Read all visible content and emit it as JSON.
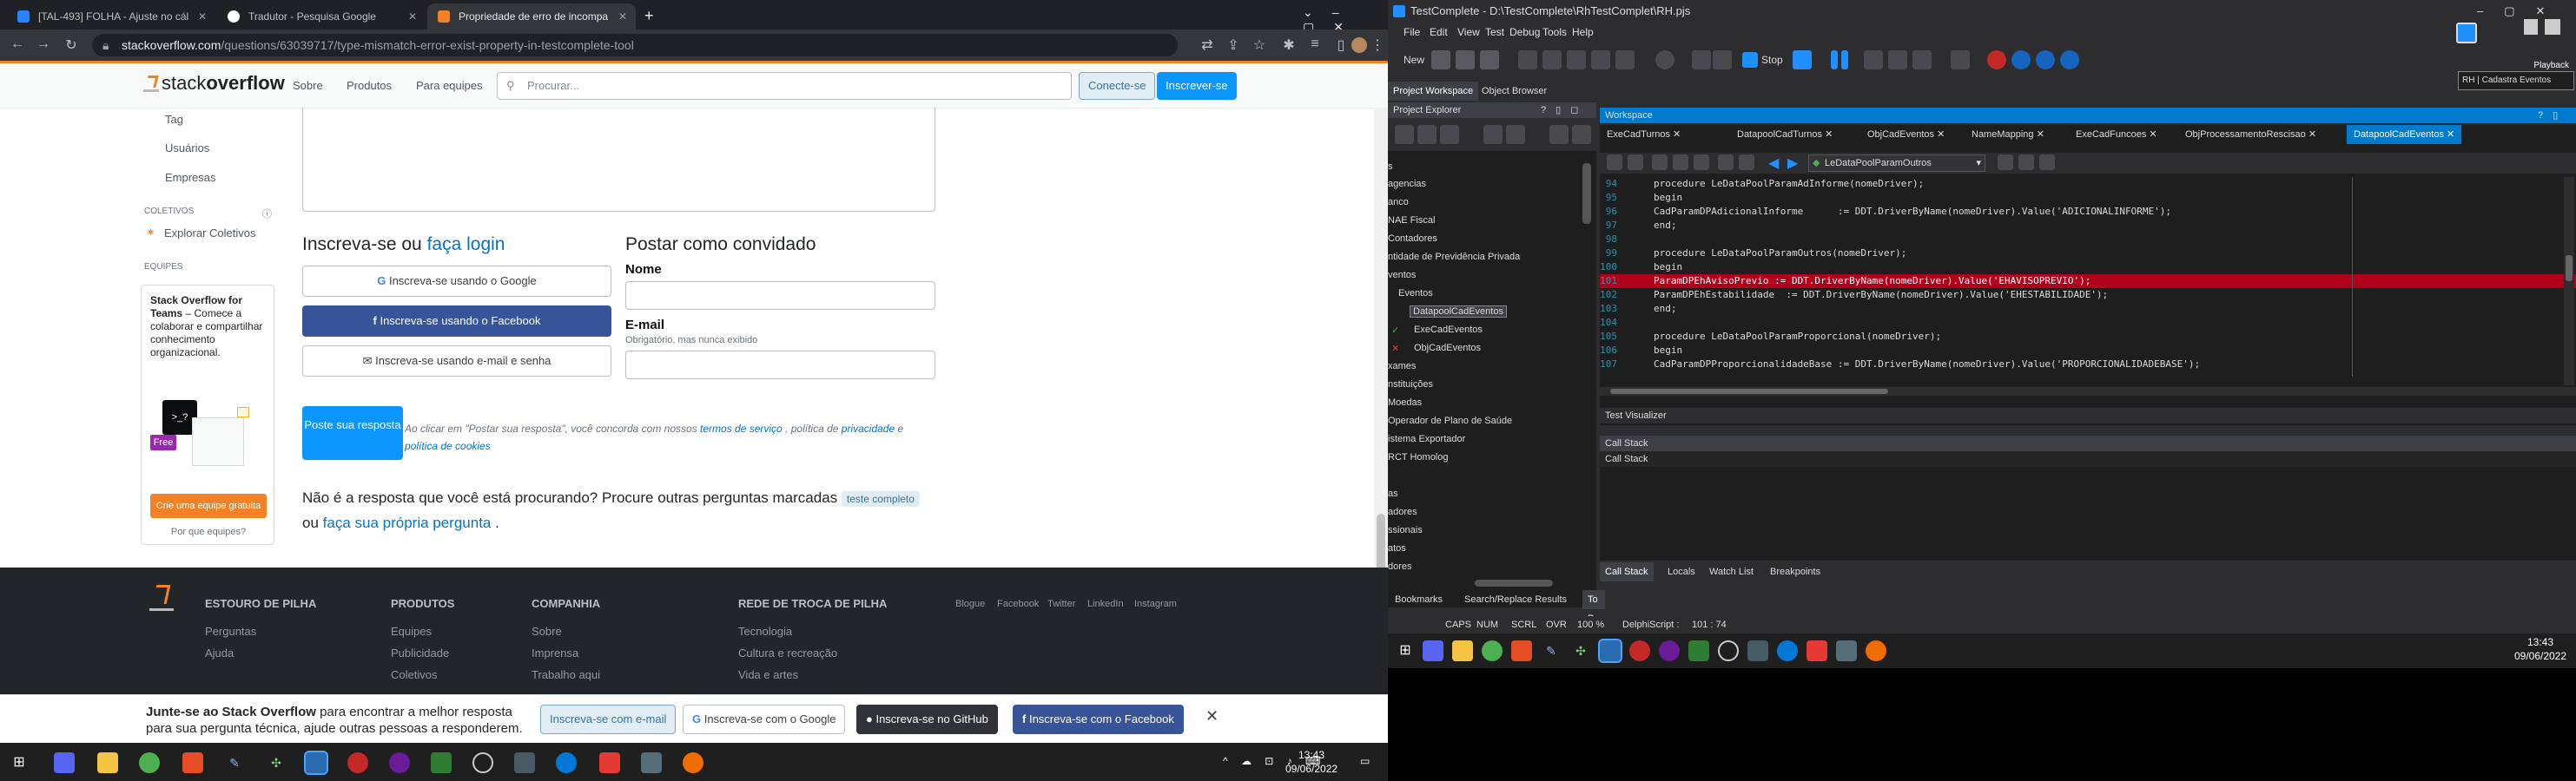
{
  "browser": {
    "tabs": [
      {
        "label": "[TAL-493] FOLHA - Ajuste no cál",
        "icon": "jira-icon",
        "active": false
      },
      {
        "label": "Tradutor - Pesquisa Google",
        "icon": "google-icon",
        "active": false
      },
      {
        "label": "Propriedade de erro de incompa",
        "icon": "stackoverflow-icon",
        "active": true
      }
    ],
    "url_host": "stackoverflow.com",
    "url_path": "/questions/63039717/type-mismatch-error-exist-property-in-testcomplete-tool"
  },
  "so": {
    "logo_a": "stack",
    "logo_b": "overflow",
    "nav": [
      "Sobre",
      "Produtos",
      "Para equipes"
    ],
    "search_placeholder": "Procurar...",
    "login": "Conecte-se",
    "signup": "Inscrever-se",
    "leftnav": {
      "tags": "Tag",
      "users": "Usuários",
      "companies": "Empresas",
      "collectives_head": "COLETIVOS",
      "explore_collectives": "Explorar Coletivos",
      "teams_head": "EQUIPES"
    },
    "teams": {
      "title": "Stack Overflow for Teams",
      "desc": "– Comece a colaborar e compartilhar conhecimento organizacional.",
      "free": "Free",
      "cta": "Crie uma equipe gratuita",
      "why": "Por que equipes?"
    },
    "signin": {
      "heading_a": "Inscreva-se ou ",
      "heading_b": "faça login",
      "google": "Inscreva-se usando o Google",
      "facebook": "Inscreva-se usando o Facebook",
      "email": "Inscreva-se usando e-mail e senha"
    },
    "guest": {
      "heading": "Postar como convidado",
      "name_label": "Nome",
      "email_label": "E-mail",
      "email_hint": "Obrigatório, mas nunca exibido"
    },
    "post_button": "Poste sua resposta",
    "fine_print": "Ao clicar em \"Postar sua resposta\", você concorda com nossos ",
    "fine_terms": "termos de serviço",
    "fine_mid": " , política de ",
    "fine_priv": "privacidade",
    "fine_and": " e ",
    "fine_cookies": "política de cookies",
    "not_answer": "Não é a resposta que você está procurando? Procure outras perguntas marcadas",
    "tag": "teste completo",
    "or": "ou ",
    "ask_link": "faça sua própria pergunta",
    "dot": " ."
  },
  "footer": {
    "brand": "ESTOURO DE PILHA",
    "brand_links": [
      "Perguntas",
      "Ajuda"
    ],
    "products_head": "PRODUTOS",
    "products": [
      "Equipes",
      "Publicidade",
      "Coletivos"
    ],
    "company_head": "COMPANHIA",
    "company": [
      "Sobre",
      "Imprensa",
      "Trabalho aqui"
    ],
    "network_head": "REDE DE TROCA DE PILHA",
    "network": [
      "Tecnologia",
      "Cultura e recreação",
      "Vida e artes"
    ],
    "social": [
      "Blogue",
      "Facebook",
      "Twitter",
      "LinkedIn",
      "Instagram"
    ]
  },
  "banner": {
    "bold": "Junte-se ao Stack Overflow",
    "text1": " para encontrar a melhor resposta",
    "text2": "para sua pergunta técnica, ajude outras pessoas a responderem.",
    "email_btn": "Inscreva-se com e-mail",
    "google_btn": "Inscreva-se com o Google",
    "github_btn": "Inscreva-se no GitHub",
    "facebook_btn": "Inscreva-se com o Facebook"
  },
  "taskbar_left": {
    "time": "13:43",
    "date": "09/06/2022"
  },
  "tc": {
    "title": "TestComplete - D:\\TestComplete\\RhTestComplet\\RH.pjs",
    "menu": [
      "File",
      "Edit",
      "View",
      "Test",
      "Debug",
      "Tools",
      "Help"
    ],
    "new": "New",
    "stop": "Stop",
    "playback": "Playback",
    "playback_sub": "RH | Cadastra Eventos",
    "panel_tabs": [
      "Project Workspace",
      "Object Browser"
    ],
    "project_explorer": "Project Explorer",
    "workspace": "Workspace",
    "tree": [
      "s",
      "agencias",
      "anco",
      "NAE Fiscal",
      "Contadores",
      "ntidade de Previdência Privada",
      "ventos",
      "Eventos",
      "DatapoolCadEventos",
      "ExeCadEventos",
      "ObjCadEventos",
      "xames",
      "nstituições",
      "Moedas",
      "Operador de Plano de Saúde",
      "istema Exportador",
      "RCT Homolog",
      "",
      "as",
      "adores",
      "ssionais",
      "atos",
      "dores"
    ],
    "ws_tabs": [
      "ExeCadTurnos",
      "DatapoolCadTurnos",
      "ObjCadEventos",
      "NameMapping",
      "ExeCadFuncoes",
      "ObjProcessamentoRescisao",
      "DatapoolCadEventos"
    ],
    "routine_select": "LeDataPoolParamOutros",
    "code": [
      {
        "n": "94",
        "t": "procedure LeDataPoolParamAdInforme(nomeDriver);"
      },
      {
        "n": "95",
        "t": "begin"
      },
      {
        "n": "96",
        "t": "CadParamDPAdicionalInforme      := DDT.DriverByName(nomeDriver).Value('ADICIONALINFORME');"
      },
      {
        "n": "97",
        "t": "end;"
      },
      {
        "n": "98",
        "t": ""
      },
      {
        "n": "99",
        "t": "procedure LeDataPoolParamOutros(nomeDriver);"
      },
      {
        "n": "100",
        "t": "begin"
      },
      {
        "n": "101",
        "t": "ParamDPEhAvisoPrevio := DDT.DriverByName(nomeDriver).Value('EHAVISOPREVIO');",
        "err": true
      },
      {
        "n": "102",
        "t": "ParamDPEhEstabilidade  := DDT.DriverByName(nomeDriver).Value('EHESTABILIDADE');"
      },
      {
        "n": "103",
        "t": "end;"
      },
      {
        "n": "104",
        "t": ""
      },
      {
        "n": "105",
        "t": "procedure LeDataPoolParamProporcional(nomeDriver);"
      },
      {
        "n": "106",
        "t": "begin"
      },
      {
        "n": "107",
        "t": "CadParamDPProporcionalidadeBase := DDT.DriverByName(nomeDriver).Value('PROPORCIONALIDADEBASE');"
      }
    ],
    "test_visualizer": "Test Visualizer",
    "call_stack_head": "Call Stack",
    "call_stack_col": "Call Stack",
    "bottom_tabs": [
      "Call Stack",
      "Locals",
      "Watch List",
      "Breakpoints"
    ],
    "lower_tabs": [
      "Bookmarks",
      "Search/Replace Results",
      "To Do"
    ],
    "status": [
      "CAPS",
      "NUM",
      "SCRL",
      "OVR",
      "100 %",
      "DelphiScript :",
      "101 :  74"
    ],
    "time": "13:43",
    "date": "09/06/2022"
  }
}
